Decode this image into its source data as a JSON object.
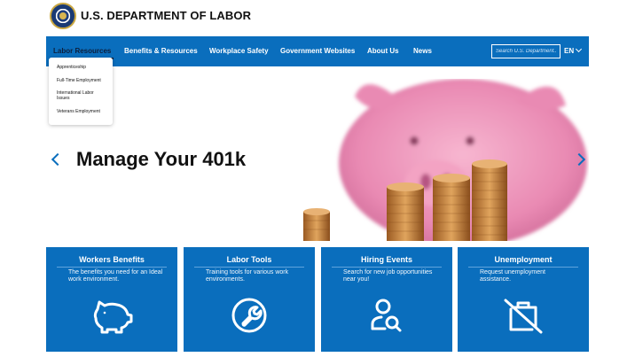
{
  "header": {
    "agency_name": "U.S. DEPARTMENT OF LABOR",
    "seal_icon": "dol-seal-icon"
  },
  "nav": {
    "items": [
      "Labor Resources",
      "Benefits & Resources",
      "Workplace Safety",
      "Government Websites",
      "About Us",
      "News"
    ],
    "active_index": 0,
    "search_placeholder": "Search U.S. Department...",
    "language": "EN",
    "background": "#0a6ebd"
  },
  "dropdown": {
    "items": [
      "Apprenticeship",
      "Full-Time Employment",
      "International Labor Issues",
      "Veterans Employment"
    ]
  },
  "hero": {
    "title": "Manage Your 401k",
    "image": "piggy-bank-with-coin-stacks",
    "prev_icon": "chevron-left-icon",
    "next_icon": "chevron-right-icon"
  },
  "cards": [
    {
      "title": "Workers Benefits",
      "description": "The benefits you need for an Ideal work environment.",
      "icon": "piggy-bank-icon"
    },
    {
      "title": "Labor Tools",
      "description": "Training tools for various work environments.",
      "icon": "wrench-icon"
    },
    {
      "title": "Hiring Events",
      "description": "Search for new job opportunities near you!",
      "icon": "person-search-icon"
    },
    {
      "title": "Unemployment",
      "description": "Request unemployment assistance.",
      "icon": "briefcase-off-icon"
    }
  ],
  "colors": {
    "primary": "#0a6ebd",
    "active_nav_text": "#0d1f3c"
  }
}
